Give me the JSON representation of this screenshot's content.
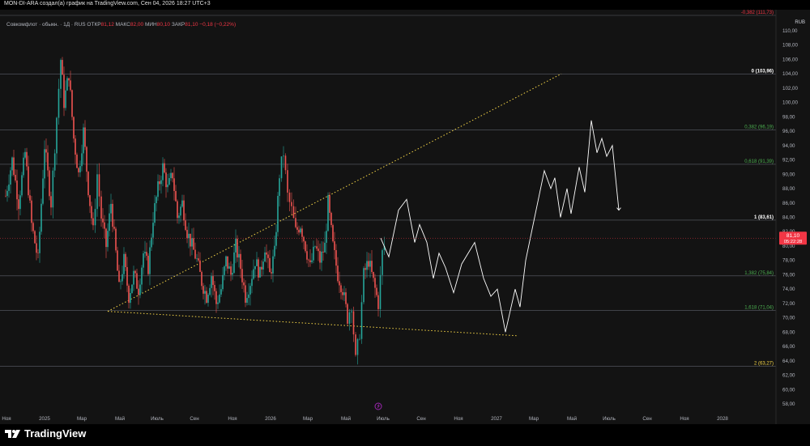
{
  "header": {
    "attribution": "MON-DI-ARA создал(а) график на TradingView.com, Сен 04, 2026 18:27 UTC+3"
  },
  "legend": {
    "symbol": "Совкомфлот · обыкн. · 1Д · RUS",
    "open_label": "ОТКР",
    "open_value": "81,12",
    "high_label": "МАКС",
    "high_value": "82,00",
    "low_label": "МИН",
    "low_value": "80,10",
    "close_label": "ЗАКР",
    "close_value": "81,10",
    "change": "−0,18 (−0,22%)"
  },
  "currency": "RUB",
  "last_price": {
    "value": 81.1,
    "label": "81,10",
    "countdown": "05:22:28"
  },
  "colors": {
    "background": "#131313",
    "up": "#26a69a",
    "down": "#ef5350",
    "fib_label": "#4caf50",
    "trendline": "#f5d547",
    "projection": "#ffffff",
    "last_price_bg": "#f23645"
  },
  "fib_levels": [
    {
      "label": "-0,382 (111,73)",
      "price": 111.73,
      "color": "#f23645"
    },
    {
      "label": "0 (103,96)",
      "price": 103.96,
      "color": "#ffffff"
    },
    {
      "label": "0,382 (96,19)",
      "price": 96.19,
      "color": "#4caf50"
    },
    {
      "label": "0,618 (91,39)",
      "price": 91.39,
      "color": "#4caf50"
    },
    {
      "label": "1 (83,61)",
      "price": 83.61,
      "color": "#ffffff"
    },
    {
      "label": "1,382 (75,84)",
      "price": 75.84,
      "color": "#4caf50"
    },
    {
      "label": "1,618 (71,04)",
      "price": 71.04,
      "color": "#4caf50"
    },
    {
      "label": "2 (63,27)",
      "price": 63.27,
      "color": "#f5d547"
    }
  ],
  "chart_data": {
    "type": "candlestick",
    "title": "",
    "y_axis": {
      "min": 58,
      "max": 110,
      "ticks": [
        "110,00",
        "108,00",
        "106,00",
        "104,00",
        "102,00",
        "100,00",
        "98,00",
        "96,00",
        "94,00",
        "92,00",
        "90,00",
        "88,00",
        "86,00",
        "84,00",
        "82,00",
        "80,00",
        "78,00",
        "76,00",
        "74,00",
        "72,00",
        "70,00",
        "68,00",
        "66,00",
        "64,00",
        "62,00",
        "60,00",
        "58,00"
      ]
    },
    "x_axis": {
      "labels": [
        "Ноя",
        "2025",
        "Мар",
        "Май",
        "Июль",
        "Сен",
        "Ноя",
        "2026",
        "Мар",
        "Май",
        "Июль",
        "Сен",
        "Ноя",
        "2027",
        "Мар",
        "Май",
        "Июль",
        "Сен",
        "Ноя",
        "2028"
      ],
      "label_positions": [
        0.0,
        0.047,
        0.093,
        0.14,
        0.186,
        0.232,
        0.279,
        0.326,
        0.372,
        0.419,
        0.465,
        0.512,
        0.558,
        0.605,
        0.651,
        0.698,
        0.744,
        0.791,
        0.837,
        0.884
      ]
    },
    "price_path": [
      [
        0.0,
        87
      ],
      [
        0.008,
        92
      ],
      [
        0.016,
        86
      ],
      [
        0.024,
        93
      ],
      [
        0.032,
        83
      ],
      [
        0.04,
        78
      ],
      [
        0.048,
        94
      ],
      [
        0.056,
        86
      ],
      [
        0.063,
        98
      ],
      [
        0.068,
        106
      ],
      [
        0.072,
        100
      ],
      [
        0.078,
        104
      ],
      [
        0.084,
        95
      ],
      [
        0.09,
        90
      ],
      [
        0.096,
        96
      ],
      [
        0.102,
        88
      ],
      [
        0.108,
        82
      ],
      [
        0.113,
        90
      ],
      [
        0.118,
        84
      ],
      [
        0.124,
        80
      ],
      [
        0.13,
        86
      ],
      [
        0.136,
        79
      ],
      [
        0.14,
        74
      ],
      [
        0.146,
        78
      ],
      [
        0.152,
        73
      ],
      [
        0.158,
        76
      ],
      [
        0.164,
        74
      ],
      [
        0.17,
        79
      ],
      [
        0.176,
        77
      ],
      [
        0.182,
        84
      ],
      [
        0.188,
        88
      ],
      [
        0.194,
        91
      ],
      [
        0.2,
        88
      ],
      [
        0.206,
        90
      ],
      [
        0.212,
        84
      ],
      [
        0.218,
        86
      ],
      [
        0.224,
        82
      ],
      [
        0.23,
        80
      ],
      [
        0.236,
        78
      ],
      [
        0.242,
        75
      ],
      [
        0.248,
        73
      ],
      [
        0.254,
        76
      ],
      [
        0.26,
        72
      ],
      [
        0.266,
        74
      ],
      [
        0.272,
        78
      ],
      [
        0.278,
        76
      ],
      [
        0.284,
        80
      ],
      [
        0.29,
        77
      ],
      [
        0.296,
        73
      ],
      [
        0.302,
        75
      ],
      [
        0.308,
        78
      ],
      [
        0.314,
        76
      ],
      [
        0.32,
        80
      ],
      [
        0.326,
        76
      ],
      [
        0.332,
        79
      ],
      [
        0.338,
        90
      ],
      [
        0.343,
        93
      ],
      [
        0.348,
        87
      ],
      [
        0.353,
        85
      ],
      [
        0.358,
        82
      ],
      [
        0.364,
        83
      ],
      [
        0.37,
        80
      ],
      [
        0.376,
        77
      ],
      [
        0.382,
        80
      ],
      [
        0.388,
        78
      ],
      [
        0.394,
        80
      ],
      [
        0.398,
        86
      ],
      [
        0.404,
        80
      ],
      [
        0.41,
        76
      ],
      [
        0.416,
        74
      ],
      [
        0.422,
        70
      ],
      [
        0.427,
        72
      ],
      [
        0.432,
        64
      ],
      [
        0.437,
        68
      ],
      [
        0.442,
        76
      ],
      [
        0.448,
        78
      ],
      [
        0.454,
        75
      ],
      [
        0.46,
        72
      ],
      [
        0.465,
        79
      ],
      [
        0.47,
        81
      ]
    ],
    "projection": [
      [
        0.47,
        81.1
      ],
      [
        0.48,
        78.5
      ],
      [
        0.492,
        85
      ],
      [
        0.502,
        86.5
      ],
      [
        0.512,
        80.5
      ],
      [
        0.518,
        83
      ],
      [
        0.527,
        80.5
      ],
      [
        0.535,
        75.5
      ],
      [
        0.542,
        79
      ],
      [
        0.55,
        77
      ],
      [
        0.56,
        73.5
      ],
      [
        0.57,
        77.5
      ],
      [
        0.586,
        80.5
      ],
      [
        0.597,
        75.5
      ],
      [
        0.606,
        73
      ],
      [
        0.614,
        74
      ],
      [
        0.624,
        68
      ],
      [
        0.636,
        74
      ],
      [
        0.642,
        71.5
      ],
      [
        0.649,
        78
      ],
      [
        0.66,
        84
      ],
      [
        0.672,
        90.5
      ],
      [
        0.68,
        88
      ],
      [
        0.685,
        89.5
      ],
      [
        0.692,
        84
      ],
      [
        0.7,
        88
      ],
      [
        0.705,
        84.5
      ],
      [
        0.715,
        91
      ],
      [
        0.722,
        87.5
      ],
      [
        0.73,
        97.5
      ],
      [
        0.737,
        93
      ],
      [
        0.743,
        95
      ],
      [
        0.749,
        92.5
      ],
      [
        0.756,
        94
      ],
      [
        0.764,
        85
      ]
    ],
    "trendlines": [
      {
        "from": [
          0.133,
          70.9
        ],
        "to": [
          0.693,
          104
        ]
      },
      {
        "from": [
          0.133,
          70.9
        ],
        "to": [
          0.638,
          67.5
        ]
      }
    ]
  }
}
